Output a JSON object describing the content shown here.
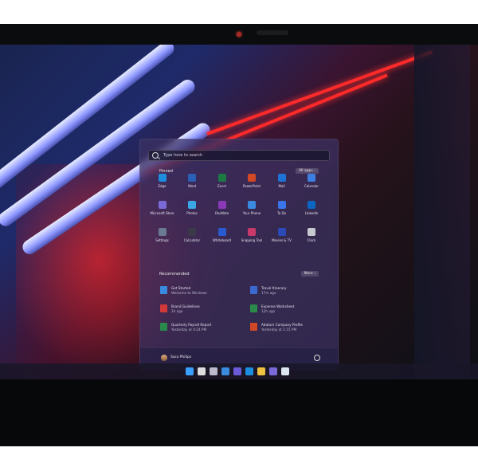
{
  "search": {
    "placeholder": "Type here to search"
  },
  "pinned": {
    "title": "Pinned",
    "all_apps": "All apps",
    "apps": [
      {
        "label": "Edge",
        "icon": "edge-icon",
        "color": "#1d8de0"
      },
      {
        "label": "Word",
        "icon": "word-icon",
        "color": "#2b5fb8"
      },
      {
        "label": "Excel",
        "icon": "excel-icon",
        "color": "#1e7a44"
      },
      {
        "label": "PowerPoint",
        "icon": "powerpoint-icon",
        "color": "#d24726"
      },
      {
        "label": "Mail",
        "icon": "mail-icon",
        "color": "#1f73d6"
      },
      {
        "label": "Calendar",
        "icon": "calendar-icon",
        "color": "#3c7fe0"
      },
      {
        "label": "Microsoft Store",
        "icon": "store-icon",
        "color": "#7a6ad8"
      },
      {
        "label": "Photos",
        "icon": "photos-icon",
        "color": "#3aa6e8"
      },
      {
        "label": "OneNote",
        "icon": "onenote-icon",
        "color": "#8a3ab8"
      },
      {
        "label": "Your Phone",
        "icon": "phone-icon",
        "color": "#3a8ae0"
      },
      {
        "label": "To Do",
        "icon": "todo-icon",
        "color": "#3a74e8"
      },
      {
        "label": "LinkedIn",
        "icon": "linkedin-icon",
        "color": "#0a66c2"
      },
      {
        "label": "Settings",
        "icon": "settings-icon",
        "color": "#6a7a90"
      },
      {
        "label": "Calculator",
        "icon": "calculator-icon",
        "color": "#3a3a48"
      },
      {
        "label": "Whiteboard",
        "icon": "whiteboard-icon",
        "color": "#2a5ad0"
      },
      {
        "label": "Snipping Tool",
        "icon": "snipping-icon",
        "color": "#c83a6a"
      },
      {
        "label": "Movies & TV",
        "icon": "movies-icon",
        "color": "#2a4ab8"
      },
      {
        "label": "Clock",
        "icon": "clock-icon",
        "color": "#c8c8d0"
      }
    ]
  },
  "recommended": {
    "title": "Recommended",
    "more": "More",
    "items": [
      {
        "title": "Get Started",
        "sub": "Welcome to Windows",
        "icon": "get-started-icon",
        "color": "#3a8ae0"
      },
      {
        "title": "Travel Itinerary",
        "sub": "17m ago",
        "icon": "word-doc-icon",
        "color": "#3a6ad0"
      },
      {
        "title": "Brand Guidelines",
        "sub": "2h ago",
        "icon": "pdf-icon",
        "color": "#d23a3a"
      },
      {
        "title": "Expense Worksheet",
        "sub": "12h ago",
        "icon": "excel-doc-icon",
        "color": "#2a8a4a"
      },
      {
        "title": "Quarterly Payroll Report",
        "sub": "Yesterday at 4:24 PM",
        "icon": "excel-doc-icon",
        "color": "#2a8a4a"
      },
      {
        "title": "Adatum Company Profile",
        "sub": "Yesterday at 1:15 PM",
        "icon": "powerpoint-doc-icon",
        "color": "#d24726"
      }
    ]
  },
  "user": {
    "name": "Sara Philips"
  },
  "taskbar": [
    {
      "icon": "windows-start-icon",
      "color": "#3aa0ff"
    },
    {
      "icon": "search-icon",
      "color": "#dddddd"
    },
    {
      "icon": "task-view-icon",
      "color": "#bbbbcc"
    },
    {
      "icon": "widgets-icon",
      "color": "#3a8ae0"
    },
    {
      "icon": "teams-chat-icon",
      "color": "#6a5ad8"
    },
    {
      "icon": "edge-icon",
      "color": "#1d8de0"
    },
    {
      "icon": "file-explorer-icon",
      "color": "#f0c040"
    },
    {
      "icon": "store-icon",
      "color": "#7a6ad8"
    },
    {
      "icon": "notepad-icon",
      "color": "#dde6f0"
    }
  ]
}
